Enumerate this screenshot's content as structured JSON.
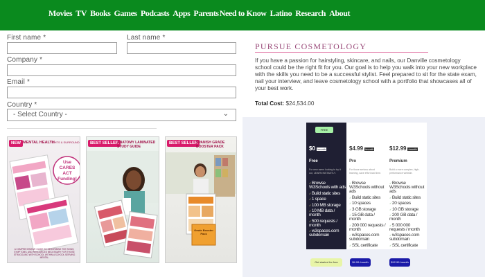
{
  "nav": {
    "items": [
      "Movies",
      "TV",
      "Books",
      "Games",
      "Podcasts",
      "Apps",
      "Parents",
      "Need to Know",
      "Latino",
      "Research",
      "About"
    ]
  },
  "form": {
    "first_name_label": "First name *",
    "last_name_label": "Last name *",
    "company_label": "Company *",
    "email_label": "Email *",
    "country_label": "Country *",
    "country_selected": "- Select Country -"
  },
  "products": [
    {
      "badge": "NEW",
      "title": "MENTAL HEALTH",
      "subtitle": "TIGHTS & SURROUND",
      "sticker": "Use CARES ACT Funding!",
      "caption": "A COMPREHENSIVE GUIDE TO DESCRIBING THE SIGNS, SYMPTOMS, AND RESOURCES NECESSARY FOR THOSE STRUGGLING WITH SCHOOL WITHIN A SCHOOL SERVING MENTAL"
    },
    {
      "badge": "BEST SELLER",
      "title": "ANATOMY LAMINATED STUDY GUIDE"
    },
    {
      "badge": "BEST SELLER",
      "title": "SPANISH GRADE BOOSTER PACK",
      "inner_label": "Grade Booster Pack"
    }
  ],
  "cosmetology": {
    "title": "PURSUE COSMETOLOGY",
    "body": "If you have a passion for hairstyling, skincare, and nails, our Danville cosmetology school could be the right fit for you. Our goal is to help you walk into your new workplace with the skills you need to be a successful stylist. Feel prepared to sit for the state exam, nail your interview, and leave cosmetology school with a portfolio that showcases all of your best work.",
    "cost_label": "Total Cost:",
    "cost_value": "$24,534.00"
  },
  "pricing": {
    "free_tag": "FREE",
    "plans": [
      {
        "price": "$0",
        "per": "/month",
        "name": "Free",
        "desc": "For new users looking to try it out, LEARN INSTANTLY.",
        "features": [
          "Browse W3Schools with ads",
          "Build static sites",
          "1 space",
          "100 MB storage",
          "10 MB data / month",
          "500 requests / month",
          "w3spaces.com subdomain"
        ],
        "button": "Get started for free"
      },
      {
        "price": "$4.99",
        "per": "/month",
        "name": "Pro",
        "desc": "For those serious about learning, save effort and time.",
        "features": [
          "Browse W3Schools without ads",
          "Build static sites",
          "10 spaces",
          "3 GB storage",
          "15 GB data / month",
          "200 000 requests / month",
          "w3spaces.com subdomain",
          "SSL certificate"
        ],
        "button": "$4.99 /month"
      },
      {
        "price": "$12.99",
        "per": "/month",
        "name": "Premium",
        "desc": "Build a more complex, high-performance website.",
        "features": [
          "Browse W3Schools without ads",
          "Build static sites",
          "20 spaces",
          "10 GB storage",
          "200 GB data / month",
          "5 000 000 requests / month",
          "w3spaces.com subdomain",
          "SSL certificate"
        ],
        "button": "$12.99 /month"
      }
    ]
  }
}
